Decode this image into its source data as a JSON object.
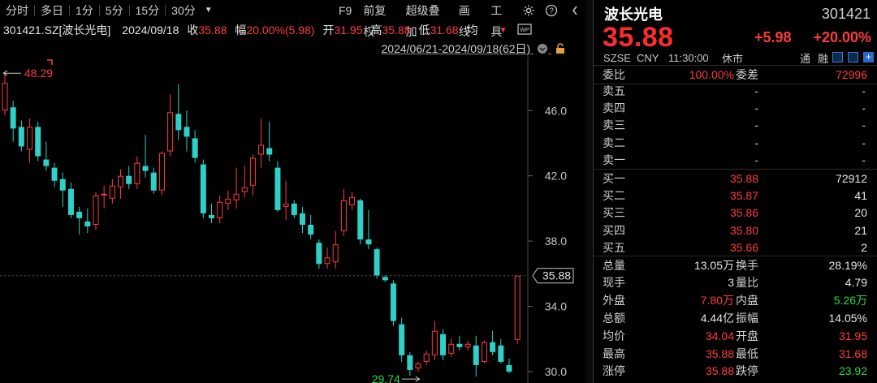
{
  "toolbar": {
    "tabs": [
      "分时",
      "多日",
      "1分",
      "5分",
      "15分",
      "30分"
    ],
    "dropdown_icon": "caret-down",
    "right_items": [
      "F9",
      "前复权",
      "超级叠加",
      "画线",
      "工具"
    ],
    "right_icons": [
      "gear-icon",
      "help-icon",
      "chevron-left-icon"
    ]
  },
  "infobar": {
    "code": "301421.SZ[波长光电]",
    "date": "2024/09/18",
    "close_label": "收",
    "close_value": "35.88",
    "change_label": "幅",
    "change_value": "20.00%(5.98)",
    "open_label": "开",
    "open_value": "31.95",
    "high_label": "高",
    "high_value": "35.88",
    "low_label": "低",
    "low_value": "31.68",
    "avg_label": "均"
  },
  "daterange": "2024/06/21-2024/09/18(62日)",
  "chart_data": {
    "type": "candlestick",
    "y_ticks": [
      "46.0",
      "42.0",
      "38.0",
      "34.0",
      "30.0"
    ],
    "y_range": [
      29.5,
      48.5
    ],
    "max_label": "48.29",
    "min_label": "29.74",
    "last_price_label": "35.88",
    "colors": {
      "up": "#ff3b3b",
      "down": "#2fd0c8",
      "grid": "#333333"
    },
    "candles": [
      {
        "o": 46.0,
        "h": 48.3,
        "l": 45.7,
        "c": 47.7
      },
      {
        "o": 46.2,
        "h": 46.6,
        "l": 44.1,
        "c": 44.9
      },
      {
        "o": 45.0,
        "h": 45.4,
        "l": 43.5,
        "c": 43.8
      },
      {
        "o": 43.6,
        "h": 45.5,
        "l": 42.8,
        "c": 45.0
      },
      {
        "o": 45.0,
        "h": 45.3,
        "l": 42.9,
        "c": 43.2
      },
      {
        "o": 43.0,
        "h": 44.1,
        "l": 42.3,
        "c": 42.6
      },
      {
        "o": 42.5,
        "h": 42.8,
        "l": 41.3,
        "c": 41.7
      },
      {
        "o": 41.8,
        "h": 42.2,
        "l": 40.1,
        "c": 41.1
      },
      {
        "o": 41.2,
        "h": 41.6,
        "l": 39.4,
        "c": 39.6
      },
      {
        "o": 39.8,
        "h": 40.1,
        "l": 38.4,
        "c": 39.4
      },
      {
        "o": 39.2,
        "h": 40.0,
        "l": 38.5,
        "c": 38.9
      },
      {
        "o": 39.0,
        "h": 41.0,
        "l": 38.7,
        "c": 40.8
      },
      {
        "o": 40.8,
        "h": 41.4,
        "l": 40.0,
        "c": 40.9
      },
      {
        "o": 40.6,
        "h": 41.8,
        "l": 40.3,
        "c": 41.4
      },
      {
        "o": 41.3,
        "h": 42.4,
        "l": 40.6,
        "c": 42.0
      },
      {
        "o": 42.0,
        "h": 42.6,
        "l": 41.2,
        "c": 41.5
      },
      {
        "o": 41.5,
        "h": 43.2,
        "l": 41.2,
        "c": 42.8
      },
      {
        "o": 42.6,
        "h": 44.5,
        "l": 41.9,
        "c": 42.3
      },
      {
        "o": 42.2,
        "h": 42.5,
        "l": 40.9,
        "c": 41.1
      },
      {
        "o": 41.1,
        "h": 43.5,
        "l": 40.8,
        "c": 43.4
      },
      {
        "o": 43.5,
        "h": 47.0,
        "l": 43.2,
        "c": 45.9
      },
      {
        "o": 45.8,
        "h": 47.6,
        "l": 44.2,
        "c": 44.8
      },
      {
        "o": 45.0,
        "h": 46.0,
        "l": 43.5,
        "c": 44.4
      },
      {
        "o": 44.3,
        "h": 44.8,
        "l": 42.8,
        "c": 43.1
      },
      {
        "o": 42.7,
        "h": 43.0,
        "l": 39.4,
        "c": 39.7
      },
      {
        "o": 39.6,
        "h": 40.3,
        "l": 39.1,
        "c": 39.4
      },
      {
        "o": 39.4,
        "h": 40.8,
        "l": 39.1,
        "c": 40.4
      },
      {
        "o": 40.3,
        "h": 41.1,
        "l": 39.9,
        "c": 40.6
      },
      {
        "o": 40.5,
        "h": 42.5,
        "l": 40.0,
        "c": 40.9
      },
      {
        "o": 41.0,
        "h": 42.6,
        "l": 40.7,
        "c": 41.3
      },
      {
        "o": 41.4,
        "h": 43.3,
        "l": 40.8,
        "c": 43.1
      },
      {
        "o": 43.3,
        "h": 45.5,
        "l": 42.5,
        "c": 43.9
      },
      {
        "o": 43.7,
        "h": 45.3,
        "l": 42.9,
        "c": 43.3
      },
      {
        "o": 42.5,
        "h": 42.9,
        "l": 39.8,
        "c": 39.9
      },
      {
        "o": 40.1,
        "h": 41.7,
        "l": 39.3,
        "c": 40.3
      },
      {
        "o": 40.3,
        "h": 40.5,
        "l": 39.4,
        "c": 39.6
      },
      {
        "o": 39.7,
        "h": 40.1,
        "l": 38.5,
        "c": 39.0
      },
      {
        "o": 39.0,
        "h": 39.6,
        "l": 38.1,
        "c": 38.4
      },
      {
        "o": 37.9,
        "h": 38.1,
        "l": 36.3,
        "c": 36.6
      },
      {
        "o": 36.6,
        "h": 37.6,
        "l": 36.3,
        "c": 37.0
      },
      {
        "o": 36.7,
        "h": 38.6,
        "l": 36.3,
        "c": 37.8
      },
      {
        "o": 38.6,
        "h": 41.2,
        "l": 38.3,
        "c": 40.5
      },
      {
        "o": 40.2,
        "h": 41.0,
        "l": 39.9,
        "c": 40.7
      },
      {
        "o": 40.5,
        "h": 40.6,
        "l": 37.8,
        "c": 38.1
      },
      {
        "o": 38.1,
        "h": 39.9,
        "l": 37.5,
        "c": 37.8
      },
      {
        "o": 37.5,
        "h": 37.6,
        "l": 35.7,
        "c": 35.9
      },
      {
        "o": 35.8,
        "h": 35.9,
        "l": 35.5,
        "c": 35.6
      },
      {
        "o": 35.4,
        "h": 35.6,
        "l": 32.8,
        "c": 33.1
      },
      {
        "o": 32.9,
        "h": 33.3,
        "l": 30.6,
        "c": 31.0
      },
      {
        "o": 31.0,
        "h": 31.2,
        "l": 29.74,
        "c": 30.1
      },
      {
        "o": 30.2,
        "h": 30.6,
        "l": 30.0,
        "c": 30.5
      },
      {
        "o": 30.6,
        "h": 31.3,
        "l": 30.4,
        "c": 31.1
      },
      {
        "o": 31.0,
        "h": 33.1,
        "l": 30.7,
        "c": 32.5
      },
      {
        "o": 32.3,
        "h": 32.6,
        "l": 30.7,
        "c": 31.0
      },
      {
        "o": 31.1,
        "h": 32.0,
        "l": 30.9,
        "c": 31.7
      },
      {
        "o": 31.7,
        "h": 32.2,
        "l": 31.3,
        "c": 31.5
      },
      {
        "o": 31.5,
        "h": 31.9,
        "l": 31.3,
        "c": 31.7
      },
      {
        "o": 31.6,
        "h": 32.2,
        "l": 29.7,
        "c": 30.4
      },
      {
        "o": 30.6,
        "h": 31.9,
        "l": 30.5,
        "c": 31.8
      },
      {
        "o": 31.8,
        "h": 32.5,
        "l": 31.0,
        "c": 31.2
      },
      {
        "o": 31.6,
        "h": 32.0,
        "l": 30.5,
        "c": 30.6
      },
      {
        "o": 30.4,
        "h": 30.8,
        "l": 29.9,
        "c": 30.0
      },
      {
        "o": 31.95,
        "h": 35.88,
        "l": 31.68,
        "c": 35.88
      }
    ]
  },
  "quote": {
    "name": "波长光电",
    "code": "301421",
    "price": "35.88",
    "change": "+5.98",
    "change_pct": "+20.00%",
    "exchange": "SZSE",
    "currency": "CNY",
    "time": "11:30:00",
    "status": "休市",
    "badge1": "通",
    "badge2": "融"
  },
  "orderbook": {
    "weibi_label": "委比",
    "weibi_value": "100.00%",
    "weicha_label": "委差",
    "weicha_value": "72996",
    "asks": [
      {
        "label": "卖五",
        "price": "-",
        "vol": "-"
      },
      {
        "label": "卖四",
        "price": "-",
        "vol": "-"
      },
      {
        "label": "卖三",
        "price": "-",
        "vol": "-"
      },
      {
        "label": "卖二",
        "price": "-",
        "vol": "-"
      },
      {
        "label": "卖一",
        "price": "-",
        "vol": "-"
      }
    ],
    "bids": [
      {
        "label": "买一",
        "price": "35.88",
        "vol": "72912"
      },
      {
        "label": "买二",
        "price": "35.87",
        "vol": "41"
      },
      {
        "label": "买三",
        "price": "35.86",
        "vol": "20"
      },
      {
        "label": "买四",
        "price": "35.80",
        "vol": "21"
      },
      {
        "label": "买五",
        "price": "35.66",
        "vol": "2"
      }
    ]
  },
  "stats": [
    {
      "l1": "总量",
      "v1": "13.05万",
      "c1": "white",
      "l2": "换手",
      "v2": "28.19%",
      "c2": "white"
    },
    {
      "l1": "现手",
      "v1": "3",
      "c1": "white",
      "l2": "量比",
      "v2": "4.79",
      "c2": "white"
    },
    {
      "l1": "外盘",
      "v1": "7.80万",
      "c1": "red",
      "l2": "内盘",
      "v2": "5.26万",
      "c2": "green"
    },
    {
      "l1": "总额",
      "v1": "4.44亿",
      "c1": "white",
      "l2": "振幅",
      "v2": "14.05%",
      "c2": "white"
    },
    {
      "l1": "均价",
      "v1": "34.04",
      "c1": "red",
      "l2": "开盘",
      "v2": "31.95",
      "c2": "red"
    },
    {
      "l1": "最高",
      "v1": "35.88",
      "c1": "red",
      "l2": "最低",
      "v2": "31.68",
      "c2": "red"
    },
    {
      "l1": "涨停",
      "v1": "35.88",
      "c1": "red",
      "l2": "跌停",
      "v2": "23.92",
      "c2": "green"
    }
  ]
}
